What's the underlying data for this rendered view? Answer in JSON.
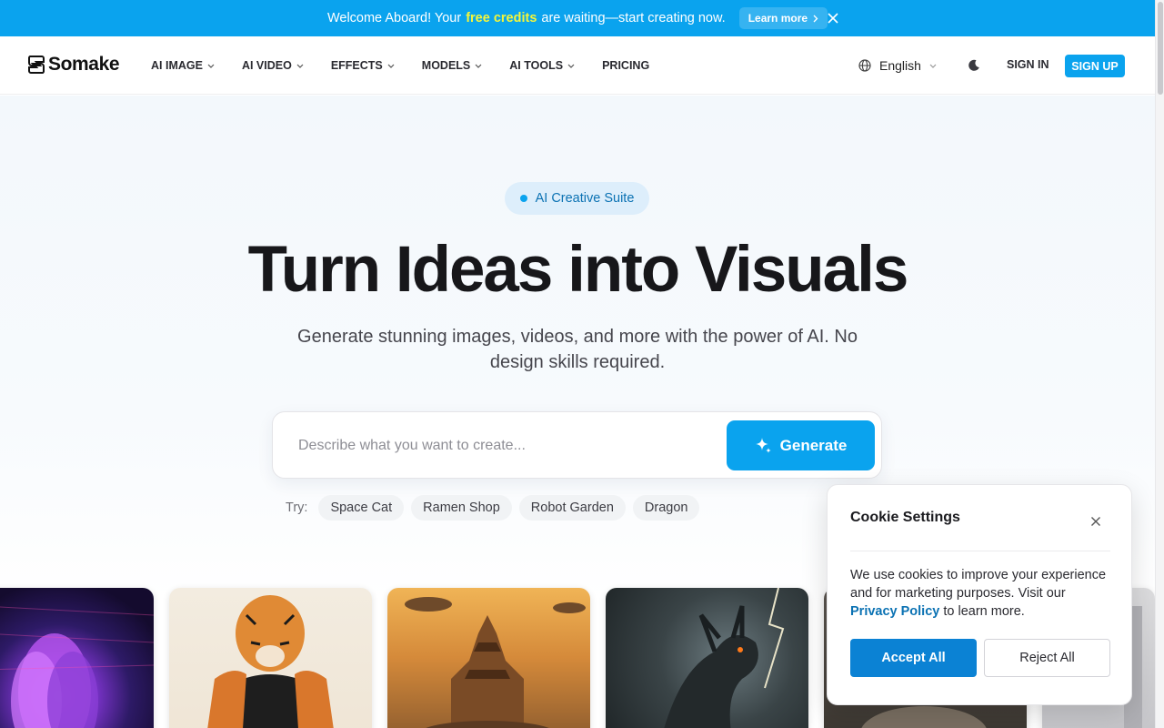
{
  "announcement": {
    "text_before": "Welcome Aboard! Your",
    "highlight": "free credits",
    "text_after": "are waiting—start creating now.",
    "learn_more": "Learn more",
    "close_icon": "close-icon"
  },
  "brand": {
    "name": "Somake",
    "accent_color": "#0aa3ee"
  },
  "nav": {
    "items": [
      {
        "label": "AI IMAGE",
        "has_dropdown": true
      },
      {
        "label": "AI VIDEO",
        "has_dropdown": true
      },
      {
        "label": "EFFECTS",
        "has_dropdown": true
      },
      {
        "label": "MODELS",
        "has_dropdown": true
      },
      {
        "label": "AI TOOLS",
        "has_dropdown": true
      },
      {
        "label": "PRICING",
        "has_dropdown": false
      }
    ],
    "language": "English",
    "sign_in": "SIGN IN",
    "sign_up": "SIGN UP"
  },
  "hero": {
    "badge": "AI Creative Suite",
    "headline": "Turn Ideas into Visuals",
    "subtitle": "Generate stunning images, videos, and more with the power of AI. No design skills required.",
    "prompt_placeholder": "Describe what you want to create...",
    "generate_label": "Generate",
    "try_label": "Try:",
    "suggestions": [
      "Space Cat",
      "Ramen Shop",
      "Robot Garden",
      "Dragon"
    ]
  },
  "gallery": {
    "cards": [
      "purple-flower-image",
      "tiger-warrior-image",
      "floating-castle-image",
      "dragon-image",
      "animal-image",
      "partial-image"
    ]
  },
  "cookie": {
    "title": "Cookie Settings",
    "text_before": "We use cookies to improve your experience and for marketing purposes. Visit our",
    "link": "Privacy Policy",
    "text_after": "to learn more.",
    "accept": "Accept All",
    "reject": "Reject All"
  }
}
